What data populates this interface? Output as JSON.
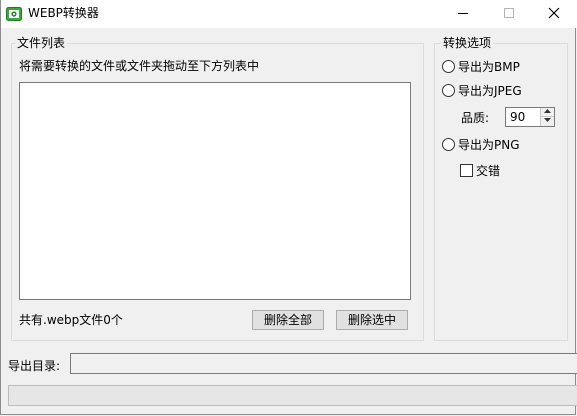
{
  "window": {
    "title": "WEBP转换器",
    "icon": "app-photo-icon",
    "controls": [
      "minimize-icon",
      "maximize-icon",
      "close-icon"
    ]
  },
  "file_list": {
    "group_title": "文件列表",
    "instruction": "将需要转换的文件或文件夹拖动至下方列表中",
    "items": [],
    "count_text": "共有.webp文件0个",
    "delete_all_label": "删除全部",
    "delete_selected_label": "删除选中"
  },
  "options": {
    "group_title": "转换选项",
    "bmp_label": "导出为BMP",
    "jpeg_label": "导出为JPEG",
    "quality_label": "品质:",
    "quality_value": "90",
    "png_label": "导出为PNG",
    "interlace_label": "交错",
    "selected_format": "",
    "interlace_checked": false
  },
  "output": {
    "dir_label": "导出目录:",
    "dir_value": ""
  },
  "progress": {
    "value": 0
  },
  "colors": {
    "background": "#f0f0f0",
    "titlebar": "#ffffff",
    "icon_green": "#3aa83a",
    "progress_fill": "#06b025"
  }
}
